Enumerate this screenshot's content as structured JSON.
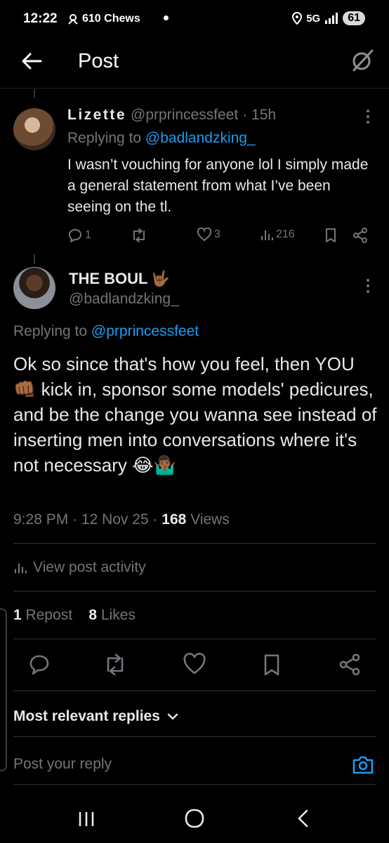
{
  "status_bar": {
    "time": "12:22",
    "app_text": "610 Chews",
    "network": "5G",
    "battery": "61"
  },
  "header": {
    "title": "Post"
  },
  "reply": {
    "name": "Lizette",
    "handle": "@prprincessfeet",
    "time": "· 15h",
    "replying_prefix": "Replying to",
    "replying_to": "@badlandzking_",
    "text": "I wasn’t vouching for anyone lol I simply made a general statement from what I’ve been seeing on the tl.",
    "replies": "1",
    "likes": "3",
    "views": "216"
  },
  "post": {
    "name": "THE BOUL",
    "name_emoji": "🤟🏾",
    "handle": "@badlandzking_",
    "replying_prefix": "Replying to",
    "replying_to": "@prprincessfeet",
    "text": "Ok so since that's how you feel, then YOU 👊🏾 kick in, sponsor some models' pedicures, and be the change you wanna see instead of inserting men into conversations where it's not necessary 😂🤷🏾‍♂️",
    "time": "9:28 PM",
    "date": "12 Nov 25",
    "views_count": "168",
    "views_label": "Views",
    "activity_label": "View post activity",
    "reposts_count": "1",
    "reposts_label": "Repost",
    "likes_count": "8",
    "likes_label": "Likes"
  },
  "replies_sort": {
    "label": "Most relevant replies"
  },
  "composer": {
    "placeholder": "Post your reply"
  },
  "colors": {
    "accent": "#1d9bf0",
    "muted": "#71767b",
    "text": "#e7e9ea",
    "background": "#000000"
  },
  "icons": [
    "arrow-left-icon",
    "grok-icon",
    "more-icon",
    "reply-icon",
    "repost-icon",
    "like-icon",
    "views-icon",
    "bookmark-icon",
    "share-icon",
    "camera-icon",
    "chevron-down-icon",
    "recents-icon",
    "home-icon",
    "back-nav-icon"
  ]
}
